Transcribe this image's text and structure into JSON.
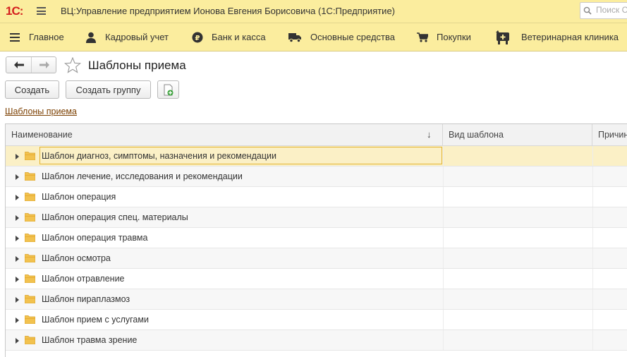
{
  "app": {
    "logo": "1С:",
    "title": "ВЦ:Управление предприятием Ионова Евгения Борисовича  (1С:Предприятие)",
    "search_placeholder": "Поиск Ct"
  },
  "sections": [
    {
      "label": "Главное",
      "icon": "menu-icon"
    },
    {
      "label": "Кадровый учет",
      "icon": "person-icon"
    },
    {
      "label": "Банк и касса",
      "icon": "ruble-coin-icon"
    },
    {
      "label": "Основные средства",
      "icon": "truck-icon"
    },
    {
      "label": "Покупки",
      "icon": "cart-icon"
    },
    {
      "label": "Ветеринарная клиника",
      "icon": "vet-clinic-icon"
    }
  ],
  "page": {
    "title": "Шаблоны приема",
    "create_label": "Создать",
    "create_group_label": "Создать группу",
    "breadcrumb": "Шаблоны приема"
  },
  "table": {
    "columns": [
      "Наименование",
      "Вид шаблона",
      "Причин"
    ],
    "sort_indicator": "↓",
    "rows": [
      "Шаблон диагноз, симптомы, назначения и рекомендации",
      "Шаблон лечение, исследования и рекомендации",
      "Шаблон операция",
      "Шаблон операция спец. материалы",
      "Шаблон операция травма",
      "Шаблон осмотра",
      "Шаблон отравление",
      "Шаблон пираплазмоз",
      "Шаблон прием с услугами",
      "Шаблон травма зрение"
    ],
    "selected_row": 0
  },
  "colors": {
    "panel_bg": "#fbed9e",
    "selected_row": "#fbf0c6",
    "focus_border": "#e3b331",
    "link": "#7b3f00",
    "folder": "#f2c24f"
  }
}
